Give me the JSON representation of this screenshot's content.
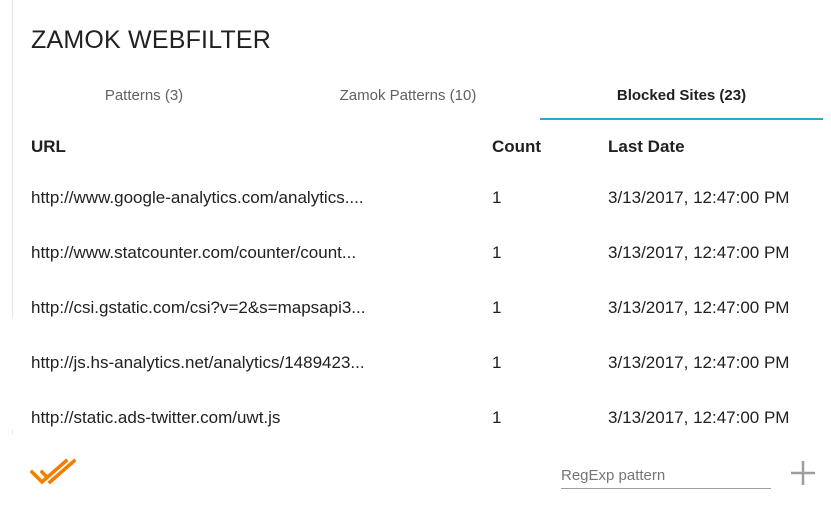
{
  "app": {
    "title": "ZAMOK WEBFILTER"
  },
  "tabs": [
    {
      "label": "Patterns (3)",
      "active": false
    },
    {
      "label": "Zamok Patterns (10)",
      "active": false
    },
    {
      "label": "Blocked Sites (23)",
      "active": true
    }
  ],
  "table": {
    "headers": {
      "url": "URL",
      "count": "Count",
      "date": "Last Date"
    },
    "rows": [
      {
        "url": "http://www.google-analytics.com/analytics....",
        "count": "1",
        "date": "3/13/2017, 12:47:00 PM"
      },
      {
        "url": "http://www.statcounter.com/counter/count...",
        "count": "1",
        "date": "3/13/2017, 12:47:00 PM"
      },
      {
        "url": "http://csi.gstatic.com/csi?v=2&s=mapsapi3...",
        "count": "1",
        "date": "3/13/2017, 12:47:00 PM"
      },
      {
        "url": "http://js.hs-analytics.net/analytics/1489423...",
        "count": "1",
        "date": "3/13/2017, 12:47:00 PM"
      },
      {
        "url": "http://static.ads-twitter.com/uwt.js",
        "count": "1",
        "date": "3/13/2017, 12:47:00 PM"
      }
    ]
  },
  "footer": {
    "pattern_placeholder": "RegExp pattern",
    "pattern_value": "",
    "check_icon": "double-check-icon",
    "add_icon": "plus-icon"
  },
  "colors": {
    "accent": "#2aa9c8",
    "check": "#f57c00",
    "add_icon": "#9e9e9e"
  }
}
